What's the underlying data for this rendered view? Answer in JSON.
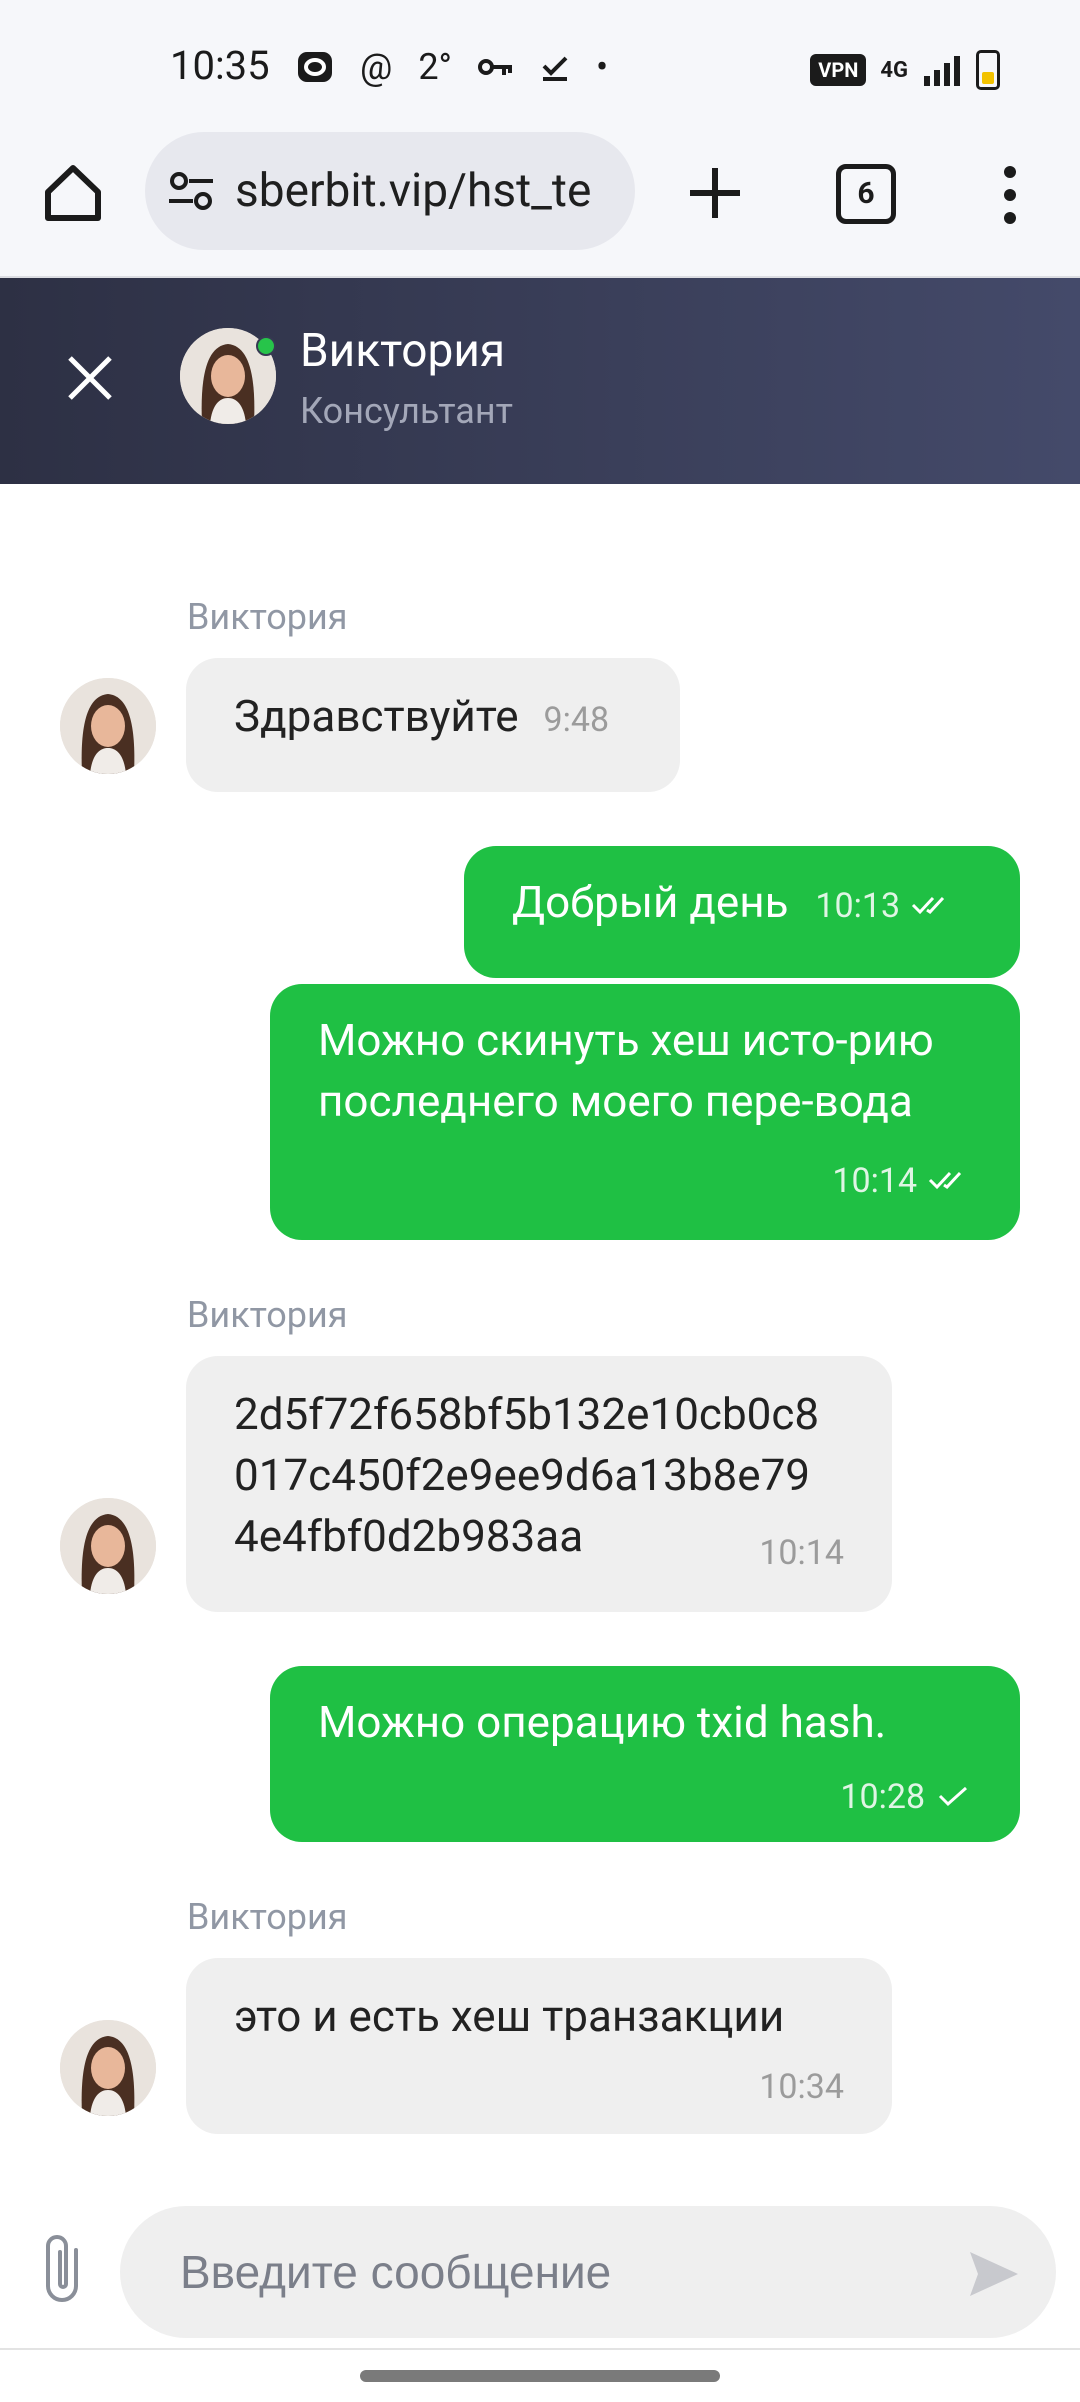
{
  "status_bar": {
    "time": "10:35",
    "notif_icons": [
      "opera-icon",
      "at-icon",
      "2°",
      "key-icon",
      "check-icon",
      "•"
    ],
    "vpn": "VPN",
    "signal": "4G"
  },
  "browser": {
    "url": "sberbit.vip/hst_te",
    "tab_count": "6"
  },
  "chat_header": {
    "name": "Виктория",
    "role": "Консультант",
    "online_color": "#27c44a"
  },
  "messages": [
    {
      "dir": "in",
      "sender": "Виктория",
      "text": "Здравствуйте",
      "time": "9:48"
    },
    {
      "dir": "out",
      "text": "Добрый день",
      "time": "10:13",
      "status": "read"
    },
    {
      "dir": "out",
      "text": "Можно скинуть хеш исто-рию последнего моего пере-вода",
      "time": "10:14",
      "status": "read"
    },
    {
      "dir": "in",
      "sender": "Виктория",
      "text": "2d5f72f658bf5b132e10cb0c8017c450f2e9ee9d6a13b8e794e4fbf0d2b983aa",
      "time": "10:14"
    },
    {
      "dir": "out",
      "text": "Можно операцию txid hash.",
      "time": "10:28",
      "status": "sent"
    },
    {
      "dir": "in",
      "sender": "Виктория",
      "text": "это и есть хеш транзакции",
      "time": "10:34"
    }
  ],
  "composer": {
    "placeholder": "Введите сообщение"
  },
  "colors": {
    "outgoing_bubble": "#1fc044",
    "incoming_bubble": "#efefef",
    "header_bg": "#363a52"
  }
}
